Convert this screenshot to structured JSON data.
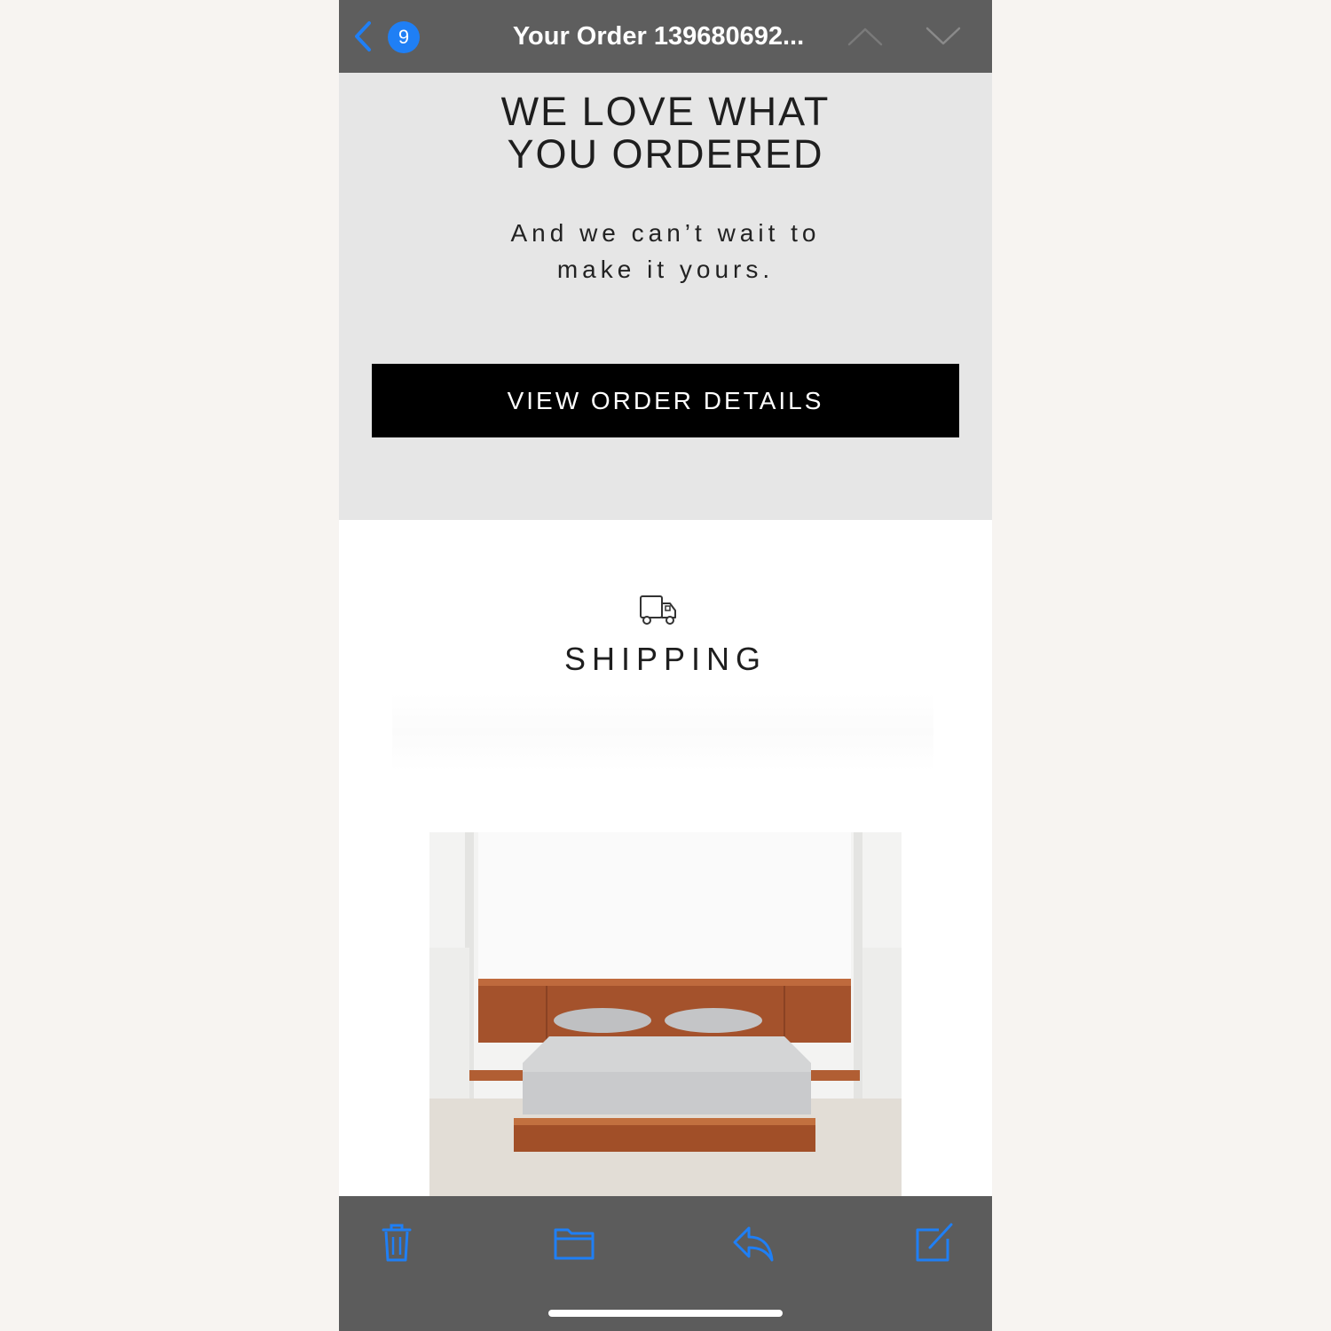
{
  "navbar": {
    "unread_count": "9",
    "title": "Your Order 139680692..."
  },
  "hero": {
    "heading_line1": "WE LOVE WHAT",
    "heading_line2": "YOU ORDERED",
    "sub_line1": "And we can’t wait to",
    "sub_line2": "make it yours.",
    "button_label": "VIEW ORDER DETAILS"
  },
  "shipping": {
    "heading": "SHIPPING"
  },
  "icons": {
    "back": "chevron-left-icon",
    "previous": "chevron-up-icon",
    "next": "chevron-down-icon",
    "shipping": "truck-icon",
    "toolbar": [
      "trash-icon",
      "folder-icon",
      "reply-icon",
      "compose-icon"
    ]
  },
  "colors": {
    "accent": "#1f7ff5",
    "navbar_bg": "#5e5e5e",
    "hero_bg": "#e6e6e6",
    "button_bg": "#000000",
    "toolbar_icon": "#1f7ff5"
  }
}
